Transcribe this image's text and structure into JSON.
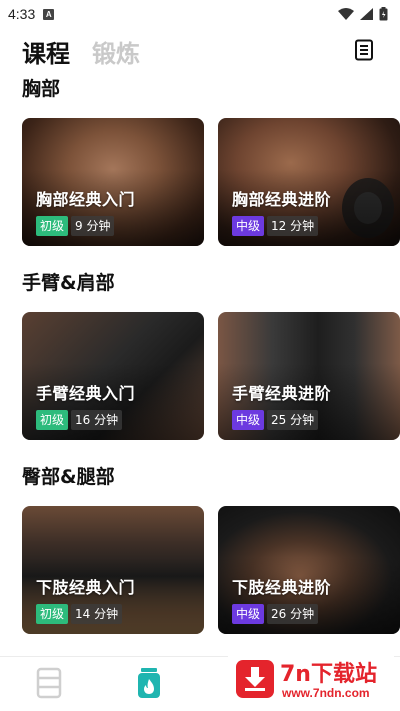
{
  "status": {
    "time": "4:33",
    "notif": "A"
  },
  "header": {
    "tabs": [
      "课程",
      "锻炼"
    ],
    "active_tab": 0
  },
  "sections": [
    {
      "title": "胸部",
      "cards": [
        {
          "title": "胸部经典入门",
          "level": "初级",
          "duration": "9 分钟"
        },
        {
          "title": "胸部经典进阶",
          "level": "中级",
          "duration": "12 分钟"
        }
      ]
    },
    {
      "title": "手臂&肩部",
      "cards": [
        {
          "title": "手臂经典入门",
          "level": "初级",
          "duration": "16 分钟"
        },
        {
          "title": "手臂经典进阶",
          "level": "中级",
          "duration": "25 分钟"
        }
      ]
    },
    {
      "title": "臀部&腿部",
      "cards": [
        {
          "title": "下肢经典入门",
          "level": "初级",
          "duration": "14 分钟"
        },
        {
          "title": "下肢经典进阶",
          "level": "中级",
          "duration": "26 分钟"
        }
      ]
    }
  ],
  "watermark": {
    "title": "7n下载站",
    "url": "www.7ndn.com"
  },
  "colors": {
    "beginner": "#2dbb7c",
    "intermediate": "#6c3ae0",
    "nav_active": "#1fb5b0",
    "watermark": "#e4242c"
  },
  "icons": {
    "menu": "document-list-icon",
    "nav_course": "course-book-icon",
    "nav_workout": "fire-jar-icon",
    "wm_logo": "download-arrow-icon"
  }
}
